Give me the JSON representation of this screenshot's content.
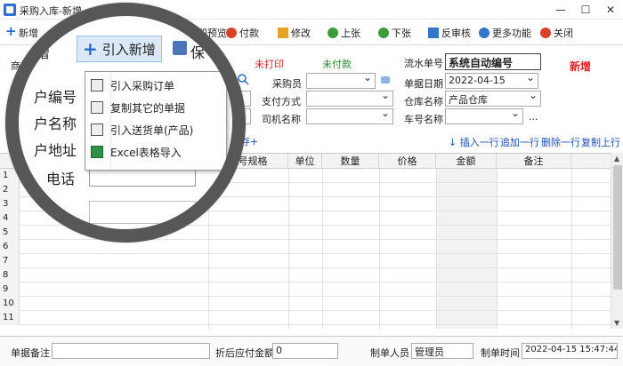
{
  "window": {
    "title": "采购入库-新增",
    "min": "—",
    "max": "☐",
    "close": "✕"
  },
  "toolbar": [
    {
      "label": "新增",
      "icon": "plus-icon"
    },
    {
      "label": "保存",
      "icon": "save-icon"
    },
    {
      "label": "打印预览",
      "icon": "print-preview-icon"
    },
    {
      "label": "付款",
      "icon": "payment-icon"
    },
    {
      "label": "修改",
      "icon": "edit-icon"
    },
    {
      "label": "上张",
      "icon": "prev-icon"
    },
    {
      "label": "下张",
      "icon": "next-icon"
    },
    {
      "label": "反审核",
      "icon": "unaudit-icon"
    },
    {
      "label": "更多功能",
      "icon": "more-icon"
    },
    {
      "label": "关闭",
      "icon": "close-icon"
    }
  ],
  "status": {
    "print": "未打印",
    "pay": "未付款",
    "mode": "新增"
  },
  "form": {
    "partial_label": "商",
    "serial_label": "流水单号",
    "serial_value": "系统自动编号",
    "date_label": "单据日期",
    "date_value": "2022-04-15",
    "buyer_label": "采购员",
    "buyer_value": "",
    "paymethod_label": "支付方式",
    "paymethod_value": "",
    "driver_label": "司机名称",
    "driver_value": "",
    "warehouse_label": "仓库名称",
    "warehouse_value": "产品仓库",
    "plate_label": "车号名称",
    "plate_value": "",
    "ellipsis": "...",
    "stock_link": "库存+"
  },
  "magnified": {
    "add_label": "增",
    "import_button": "引入新增",
    "save_partial": "保",
    "customer_code": "户编号",
    "customer_name": "户名称",
    "customer_address": "户地址",
    "phone": "电话",
    "menu": [
      {
        "label": "引入采购订单",
        "icon": "purchase-order-icon"
      },
      {
        "label": "复制其它的单据",
        "icon": "copy-document-icon"
      },
      {
        "label": "引入送货单(产品)",
        "icon": "delivery-note-icon"
      },
      {
        "label": "Excel表格导入",
        "icon": "excel-icon"
      }
    ]
  },
  "grid_actions": [
    "↓ 插入一行",
    "追加一行",
    "删除一行",
    "复制上行"
  ],
  "grid": {
    "columns": [
      "型号规格",
      "单位",
      "数量",
      "价格",
      "金额",
      "备注"
    ],
    "rows": [
      "1",
      "2",
      "3",
      "4",
      "5",
      "6",
      "7",
      "8",
      "9",
      "10",
      "11"
    ]
  },
  "footer": {
    "note_label": "单据备注",
    "note_value": "",
    "discount_label": "折后应付金额",
    "discount_value": "0",
    "creator_label": "制单人员",
    "creator_value": "管理员",
    "time_label": "制单时间",
    "time_value": "2022-04-15 15:47:44"
  },
  "colors": {
    "accent": "#1b4fb5",
    "status_red": "#dd2222",
    "status_green": "#2a8a2a",
    "mode_red": "#e02020"
  }
}
